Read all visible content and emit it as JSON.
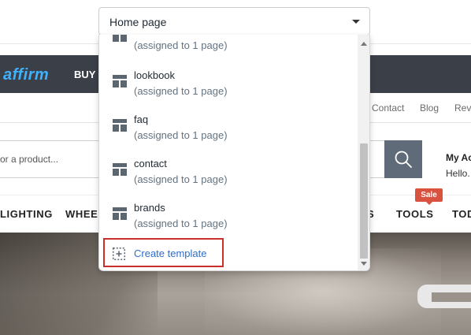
{
  "selector": {
    "value": "Home page"
  },
  "templates": [
    {
      "name": "",
      "assigned": "(assigned to 1 page)"
    },
    {
      "name": "lookbook",
      "assigned": "(assigned to 1 page)"
    },
    {
      "name": "faq",
      "assigned": "(assigned to 1 page)"
    },
    {
      "name": "contact",
      "assigned": "(assigned to 1 page)"
    },
    {
      "name": "brands",
      "assigned": "(assigned to 1 page)"
    }
  ],
  "create_template": {
    "label": "Create template"
  },
  "storefront": {
    "brand": "affirm",
    "buy_now": "BUY N",
    "links": [
      "Contact",
      "Blog",
      "Rev"
    ],
    "search_placeholder": "or a product...",
    "account_title": "My Ac",
    "account_sub": "Hello.",
    "nav": [
      "LIGHTING",
      "WHEEL",
      "S",
      "TOOLS",
      "TOD"
    ],
    "sale_badge": "Sale"
  },
  "colors": {
    "accent_link": "#2c6ecb",
    "highlight_border": "#c9302c",
    "sale": "#d9523f",
    "header_dark": "#3b4048"
  }
}
